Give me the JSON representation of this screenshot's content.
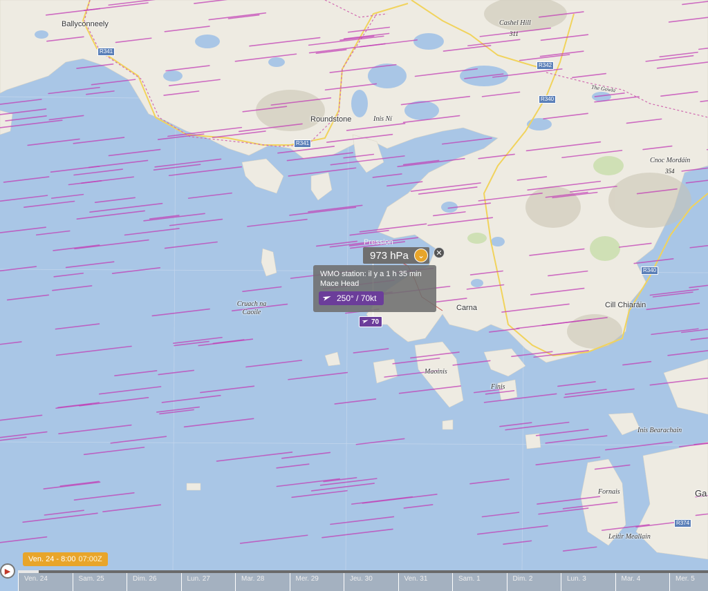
{
  "colors": {
    "water": "#a9c6e6",
    "land": "#eeebe2",
    "wind_streak": "#c23fb5",
    "accent_orange": "#e8a52a",
    "wind_purple": "#6b3d9a",
    "road_yellow": "#f1d35c",
    "road_shield": "#5a7fb8"
  },
  "places": [
    {
      "name": "Ballyconneely",
      "style": "town"
    },
    {
      "name": "Roundstone",
      "style": "town"
    },
    {
      "name": "Inis Ní",
      "style": "italic"
    },
    {
      "name": "Cashel Hill",
      "style": "italic"
    },
    {
      "name": "The Gowla",
      "style": "italic"
    },
    {
      "name": "Cnoc Mordáin",
      "style": "italic"
    },
    {
      "name": "Cruach na Caoile",
      "style": "italic"
    },
    {
      "name": "Carna",
      "style": "town"
    },
    {
      "name": "Cill Chiaráin",
      "style": "town"
    },
    {
      "name": "Maoinis",
      "style": "italic"
    },
    {
      "name": "Finis",
      "style": "italic"
    },
    {
      "name": "Inis Bearachain",
      "style": "italic"
    },
    {
      "name": "Fornais",
      "style": "italic"
    },
    {
      "name": "Leitir Meallain",
      "style": "italic"
    },
    {
      "name": "Ga",
      "style": "town"
    }
  ],
  "peaks": [
    {
      "elevation": "311"
    },
    {
      "elevation": "354"
    }
  ],
  "roads": [
    "R341",
    "R341",
    "R342",
    "R340",
    "R340",
    "R374"
  ],
  "popup": {
    "pressure_label": "Pression",
    "pressure_value": "973 hPa",
    "dropdown_icon": "chevron-down-icon",
    "close_icon": "close-icon",
    "station_line": "WMO station: il y a 1 h 35 min",
    "station_name": "Mace Head",
    "wind_icon": "wind-arrow-icon",
    "wind_reading": "250° / 70kt"
  },
  "station_marker": {
    "speed": "70"
  },
  "timeline": {
    "current_label": "Ven. 24 - 8:00",
    "current_zulu": "07:00Z",
    "progress": 0.03,
    "days": [
      "Ven. 24",
      "Sam. 25",
      "Dim. 26",
      "Lun. 27",
      "Mar. 28",
      "Mer. 29",
      "Jeu. 30",
      "Ven. 31",
      "Sam. 1",
      "Dim. 2",
      "Lun. 3",
      "Mar. 4",
      "Mer. 5"
    ]
  }
}
